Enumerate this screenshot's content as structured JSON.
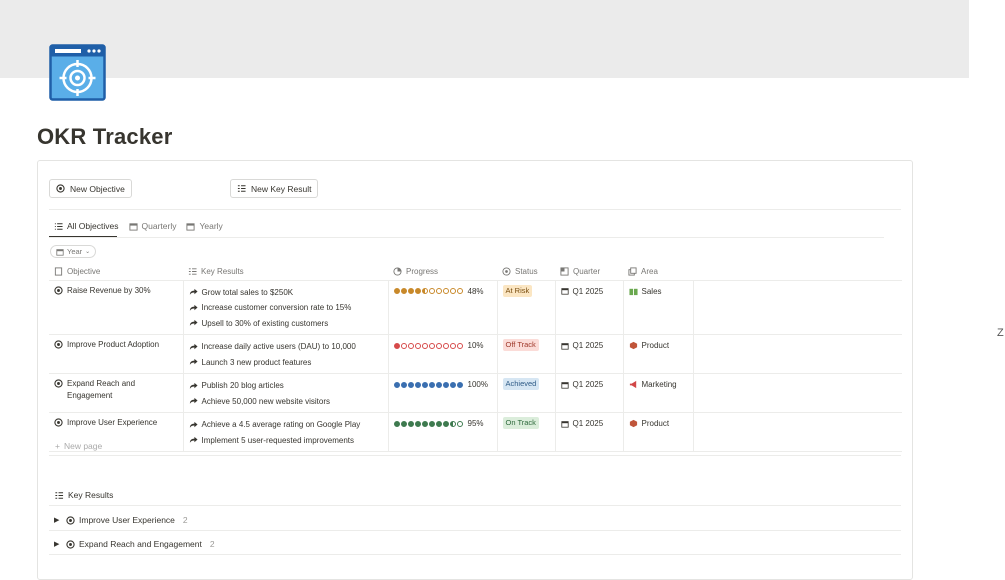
{
  "page": {
    "title": "OKR Tracker",
    "edge_char": "Z",
    "icon_colors": {
      "frame": "#1f5fa8",
      "fill": "#5aaee8",
      "inner": "#ffffff"
    }
  },
  "toolbar": {
    "new_objective": "New Objective",
    "new_key_result": "New Key Result"
  },
  "tabs": [
    {
      "label": "All Objectives",
      "icon": "list-icon",
      "active": true
    },
    {
      "label": "Quarterly",
      "icon": "calendar-icon",
      "active": false
    },
    {
      "label": "Yearly",
      "icon": "calendar-icon",
      "active": false
    }
  ],
  "filter": {
    "label": "Year",
    "icon": "calendar-icon"
  },
  "columns": [
    {
      "label": "Objective",
      "icon": "page-icon"
    },
    {
      "label": "Key Results",
      "icon": "checklist-icon"
    },
    {
      "label": "Progress",
      "icon": "progress-icon"
    },
    {
      "label": "Status",
      "icon": "status-icon"
    },
    {
      "label": "Quarter",
      "icon": "quarter-icon"
    },
    {
      "label": "Area",
      "icon": "area-icon"
    }
  ],
  "rows": [
    {
      "objective": "Raise Revenue by 30%",
      "key_results": [
        "Grow total sales to $250K",
        "Increase customer conversion rate to 15%",
        "Upsell to 30% of existing customers"
      ],
      "progress_filled": 4,
      "progress_half": true,
      "progress_total": 10,
      "progress_color": "#c8892a",
      "progress_label": "48%",
      "status": "At Risk",
      "status_bg": "#fbe6c3",
      "status_fg": "#7a4e10",
      "quarter": "Q1 2025",
      "area": "Sales",
      "area_icon": "money-icon",
      "area_color": "#6aa84f"
    },
    {
      "objective": "Improve Product Adoption",
      "key_results": [
        "Increase daily active users (DAU) to 10,000",
        "Launch 3 new product features"
      ],
      "progress_filled": 1,
      "progress_half": false,
      "progress_total": 10,
      "progress_color": "#d64a4a",
      "progress_label": "10%",
      "status": "Off Track",
      "status_bg": "#fbdcd8",
      "status_fg": "#a03a2c",
      "quarter": "Q1 2025",
      "area": "Product",
      "area_icon": "box-icon",
      "area_color": "#c0553a"
    },
    {
      "objective": "Expand Reach and Engagement",
      "key_results": [
        "Publish 20 blog articles",
        "Achieve 50,000 new website visitors"
      ],
      "progress_filled": 10,
      "progress_half": false,
      "progress_total": 10,
      "progress_color": "#3a6fb0",
      "progress_label": "100%",
      "status": "Achieved",
      "status_bg": "#d6e6f3",
      "status_fg": "#2f5b86",
      "quarter": "Q1 2025",
      "area": "Marketing",
      "area_icon": "megaphone-icon",
      "area_color": "#d14646"
    },
    {
      "objective": "Improve User Experience",
      "key_results": [
        "Achieve a 4.5 average rating on Google Play",
        "Implement 5 user-requested improvements"
      ],
      "progress_filled": 8,
      "progress_half": true,
      "progress_total": 10,
      "progress_color": "#3e7a4f",
      "progress_label": "95%",
      "status": "On Track",
      "status_bg": "#dbeddb",
      "status_fg": "#2f6a3d",
      "quarter": "Q1 2025",
      "area": "Product",
      "area_icon": "box-icon",
      "area_color": "#c0553a"
    }
  ],
  "new_page": "New page",
  "key_results_section": {
    "title": "Key Results",
    "groups": [
      {
        "label": "Improve User Experience",
        "count": "2"
      },
      {
        "label": "Expand Reach and Engagement",
        "count": "2"
      }
    ]
  }
}
